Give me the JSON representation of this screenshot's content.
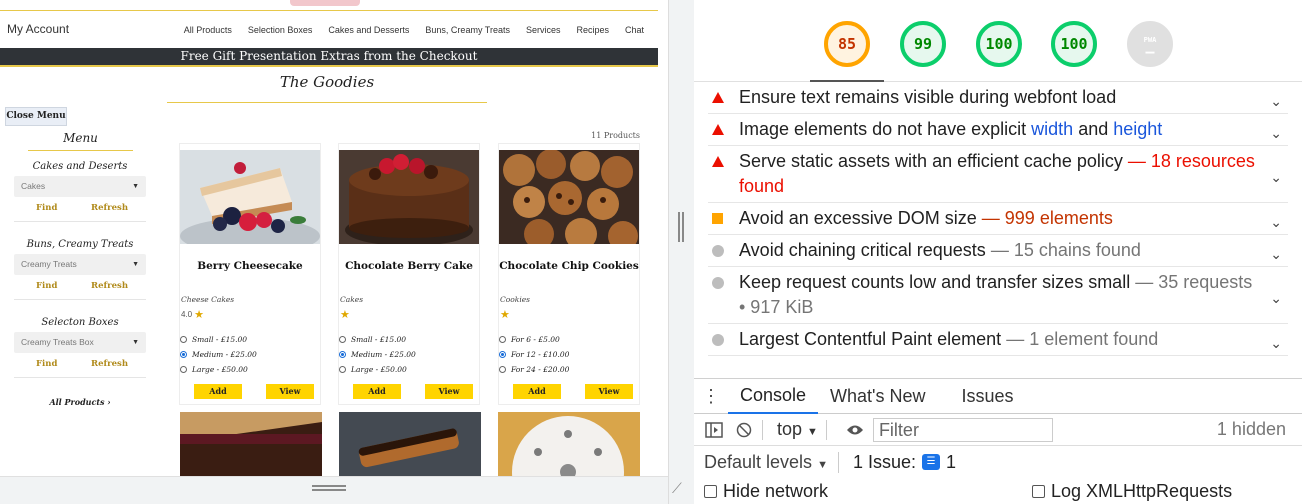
{
  "site": {
    "account": "My Account",
    "nav": [
      "All Products",
      "Selection Boxes",
      "Cakes and Desserts",
      "Buns, Creamy Treats",
      "Services",
      "Recipes",
      "Chat"
    ],
    "promo": "Free Gift Presentation Extras from the Checkout",
    "section_title": "The Goodies",
    "close_menu": "Close Menu",
    "menu_title": "Menu",
    "filters": [
      {
        "title": "Cakes and Deserts",
        "selected": "Cakes",
        "find": "Find",
        "refresh": "Refresh"
      },
      {
        "title": "Buns, Creamy Treats",
        "selected": "Creamy Treats",
        "find": "Find",
        "refresh": "Refresh"
      },
      {
        "title": "Selecton Boxes",
        "selected": "Creamy Treats Box",
        "find": "Find",
        "refresh": "Refresh"
      }
    ],
    "all_products_link": "All Products",
    "product_count": "11 Products",
    "products": [
      {
        "name": "Berry Cheesecake",
        "category": "Cheese Cakes",
        "rating": "4.0",
        "options": [
          "Small - £15.00",
          "Medium - £25.00",
          "Large - £50.00"
        ],
        "selected": 1,
        "add": "Add",
        "view": "View"
      },
      {
        "name": "Chocolate Berry Cake",
        "category": "Cakes",
        "rating": "",
        "options": [
          "Small - £15.00",
          "Medium - £25.00",
          "Large - £50.00"
        ],
        "selected": 1,
        "add": "Add",
        "view": "View"
      },
      {
        "name": "Chocolate Chip Cookies",
        "category": "Cookies",
        "rating": "",
        "options": [
          "For 6 - £5.00",
          "For 12 - £10.00",
          "For 24 - £20.00"
        ],
        "selected": 1,
        "add": "Add",
        "view": "View"
      }
    ]
  },
  "lighthouse": {
    "scores": [
      {
        "value": "85",
        "status": "average"
      },
      {
        "value": "99",
        "status": "pass"
      },
      {
        "value": "100",
        "status": "pass"
      },
      {
        "value": "100",
        "status": "pass"
      },
      {
        "value": "PWA",
        "status": "na"
      }
    ],
    "audits": [
      {
        "severity": "fail",
        "text": "Ensure text remains visible during webfont load",
        "detail": ""
      },
      {
        "severity": "fail",
        "text_a": "Image elements do not have explicit ",
        "code1": "width",
        "text_b": " and ",
        "code2": "height"
      },
      {
        "severity": "fail",
        "text": "Serve static assets with an efficient cache policy",
        "detail": "— 18 resources found"
      },
      {
        "severity": "average",
        "text": "Avoid an excessive DOM size",
        "detail": "— 999 elements"
      },
      {
        "severity": "info",
        "text": "Avoid chaining critical requests",
        "detail": "— 15 chains found"
      },
      {
        "severity": "info",
        "text": "Keep request counts low and transfer sizes small",
        "detail": "— 35 requests • 917 KiB"
      },
      {
        "severity": "info",
        "text": "Largest Contentful Paint element",
        "detail": "— 1 element found"
      }
    ]
  },
  "drawer": {
    "tabs": [
      "Console",
      "What's New",
      "Issues"
    ],
    "context": "top",
    "filter_placeholder": "Filter",
    "hidden": "1 hidden",
    "levels": "Default levels",
    "issues_label": "1 Issue:",
    "issues_count": "1",
    "hide_network": "Hide network",
    "log_xhr": "Log XMLHttpRequests"
  },
  "colors": {
    "accent_gold": "#e7c84a",
    "button_yellow": "#ffd400",
    "fail_red": "#eb0f00",
    "average_orange": "#ffa400",
    "pass_green": "#0cce6b"
  }
}
